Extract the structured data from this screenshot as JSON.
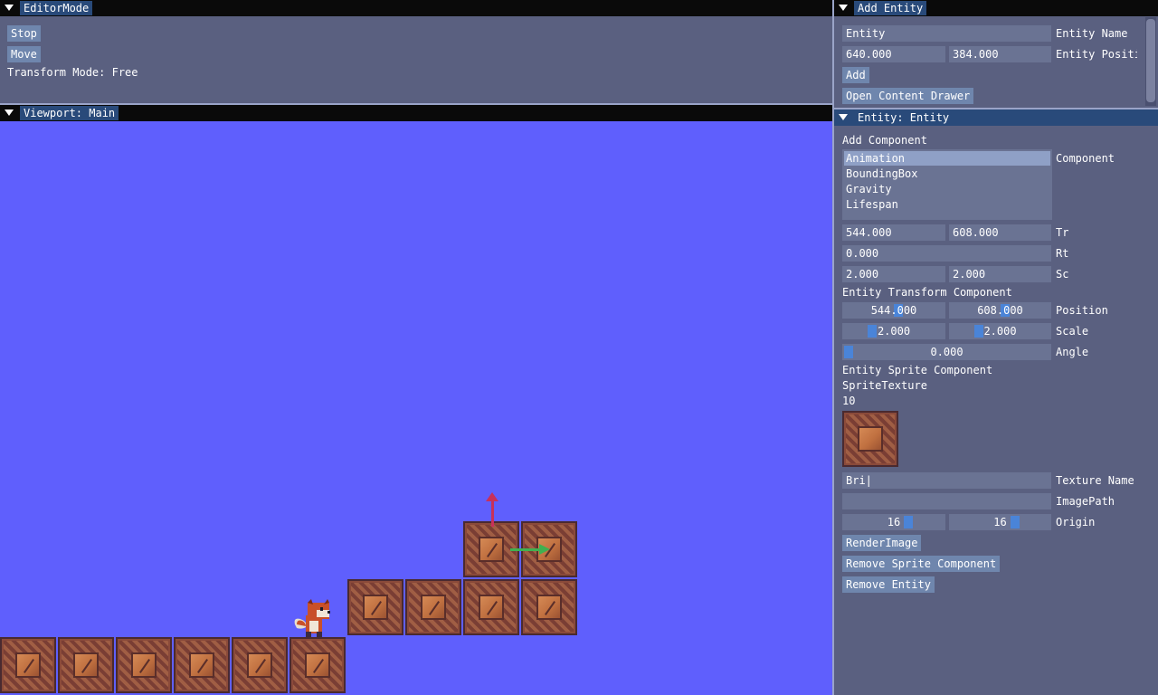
{
  "editor_mode": {
    "title": "EditorMode",
    "stop_label": "Stop",
    "move_label": "Move",
    "transform_mode": "Transform Mode: Free"
  },
  "add_entity": {
    "title": "Add Entity",
    "name_value": "Entity",
    "name_label": "Entity Name",
    "pos_x": "640.000",
    "pos_y": "384.000",
    "pos_label": "Entity Positio",
    "add_label": "Add",
    "open_drawer_label": "Open Content Drawer"
  },
  "viewport": {
    "title": "Viewport: Main",
    "background": "#5f5ffd"
  },
  "entity": {
    "title": "Entity: Entity",
    "add_component_label": "Add Component",
    "component_label": "Component",
    "components": [
      "Animation",
      "BoundingBox",
      "Gravity",
      "Lifespan"
    ],
    "selected_component": "Animation",
    "tr_x": "544.000",
    "tr_y": "608.000",
    "tr_label": "Tr",
    "rt": "0.000",
    "rt_label": "Rt",
    "sc_x": "2.000",
    "sc_y": "2.000",
    "sc_label": "Sc",
    "transform_header": "Entity Transform Component",
    "position_x": "544.000",
    "position_y": "608.000",
    "position_label": "Position",
    "scale_x": "2.000",
    "scale_y": "2.000",
    "scale_label": "Scale",
    "angle": "0.000",
    "angle_label": "Angle",
    "sprite_header": "Entity Sprite Component",
    "sprite_texture_label": "SpriteTexture",
    "texture_id": "10",
    "texture_name_value": "Bri|",
    "texture_name_label": "Texture Name",
    "image_path_value": "",
    "image_path_label": "ImagePath",
    "origin_x": "16",
    "origin_y": "16",
    "origin_label": "Origin",
    "render_image_label": "RenderImage",
    "remove_sprite_label": "Remove Sprite Component",
    "remove_entity_label": "Remove Entity"
  },
  "colors": {
    "panel_bg": "#5a6080",
    "title_active": "#294a7a",
    "button": "#6f86ad",
    "field": "#6a7393",
    "gizmo_y": "#c8305a",
    "gizmo_x": "#40b050"
  },
  "icons": [
    "collapse-triangle-icon",
    "gizmo-y-arrow-icon",
    "gizmo-x-arrow-icon",
    "fox-player-sprite",
    "brick-crate-sprite"
  ]
}
